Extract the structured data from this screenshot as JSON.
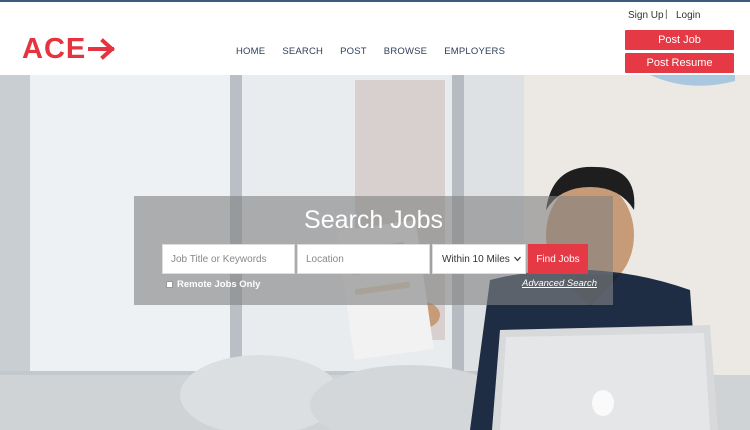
{
  "topbar": {
    "signup": "Sign Up",
    "separator": "|",
    "login": "Login"
  },
  "logo": {
    "text": "ACE",
    "icon": "arrow-right-icon",
    "color": "#e53340"
  },
  "nav": {
    "items": [
      "HOME",
      "SEARCH",
      "POST",
      "BROWSE",
      "EMPLOYERS"
    ]
  },
  "actions": {
    "post_job": "Post Job",
    "post_resume": "Post Resume"
  },
  "search": {
    "title": "Search Jobs",
    "keywords_placeholder": "Job Title or Keywords",
    "location_placeholder": "Location",
    "radius_value": "Within 10 Miles",
    "find_label": "Find Jobs",
    "remote_label": "Remote Jobs Only",
    "advanced_label": "Advanced Search"
  },
  "colors": {
    "accent": "#e63946",
    "nav_text": "#2f3e57",
    "top_rule": "#3d5a80"
  }
}
